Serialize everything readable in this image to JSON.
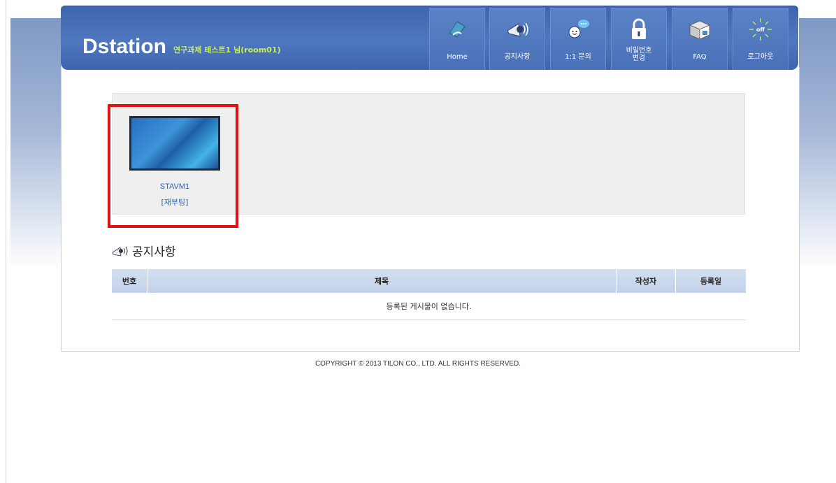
{
  "header": {
    "logo": "Dstation",
    "user_info": "연구과제 테스트1 님(room01)"
  },
  "nav": {
    "home": "Home",
    "notice": "공지사항",
    "qna": "1:1 문의",
    "password_line1": "비밀번호",
    "password_line2": "변경",
    "faq": "FAQ",
    "logout": "로그아웃",
    "logout_icon_text": "off"
  },
  "vm": {
    "name": "STAVM1",
    "reboot_label": "[재부팅]"
  },
  "notice": {
    "title": "공지사항",
    "columns": [
      "번호",
      "제목",
      "작성자",
      "등록일"
    ],
    "empty_message": "등록된 게시물이 없습니다."
  },
  "footer": {
    "copyright": "COPYRIGHT © 2013 TILON CO., LTD. ALL RIGHTS RESERVED."
  },
  "colors": {
    "header_blue": "#4a71b8",
    "user_info_green": "#c7f05a",
    "link_blue": "#2a63b8",
    "highlight_red": "#e01212"
  }
}
